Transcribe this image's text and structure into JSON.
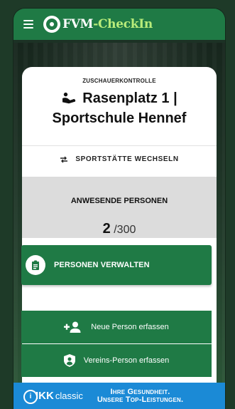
{
  "app": {
    "brand_part1": "FVM",
    "brand_part2": "-CheckIn"
  },
  "card": {
    "eyebrow": "ZUSCHAUERKONTROLLE",
    "title_line1": "Rasenplatz 1 |",
    "title_line2": "Sportschule Hennef",
    "switch_label": "SPORTSTÄTTE WECHSELN"
  },
  "counter": {
    "label": "ANWESENDE PERSONEN",
    "current": "2",
    "max": "/300"
  },
  "actions": {
    "manage": "PERSONEN VERWALTEN",
    "new_person": "Neue Person erfassen",
    "club_person": "Vereins-Person erfassen"
  },
  "footer": {
    "logo_ikk": "IKK",
    "logo_classic": "classic",
    "slogan_line1": "Ihre Gesundheit.",
    "slogan_line2": "Unsere Top-Leistungen."
  },
  "colors": {
    "primary": "#1f7a45",
    "accent": "#b8ec7a",
    "footer": "#1b8ad6"
  },
  "icons": {
    "menu": "hamburger-icon",
    "logo": "fvm-logo-icon",
    "venue": "stadium-seat-icon",
    "switch": "swap-arrows-icon",
    "manage": "clipboard-icon",
    "new_person": "person-add-icon",
    "club_person": "account-shield-icon"
  }
}
